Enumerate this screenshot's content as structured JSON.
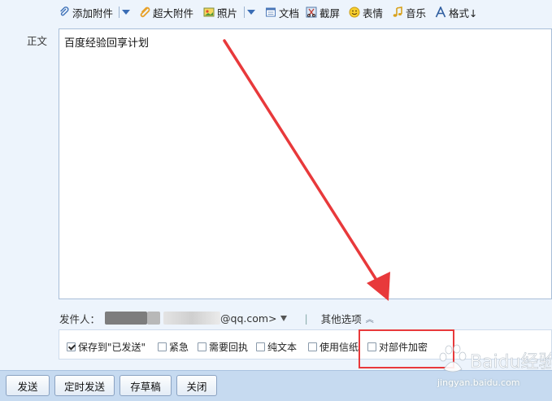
{
  "toolbar": {
    "add_attachment": "添加附件",
    "large_attachment": "超大附件",
    "photo": "照片",
    "document": "文档",
    "screenshot": "截屏",
    "emoji": "表情",
    "music": "音乐",
    "format": "格式↓"
  },
  "compose": {
    "body_label": "正文",
    "body_text": "百度经验回享计划"
  },
  "sender": {
    "label": "发件人：",
    "email_suffix": "@qq.com>",
    "other_options": "其他选项"
  },
  "options": {
    "save_to_sent": "保存到\"已发送\"",
    "urgent": "紧急",
    "need_receipt": "需要回执",
    "plain_text": "纯文本",
    "use_stationery": "使用信纸",
    "encrypt": "对部件加密",
    "save_to_sent_checked": true
  },
  "actions": {
    "send": "发送",
    "scheduled_send": "定时发送",
    "save_draft": "存草稿",
    "close": "关闭"
  },
  "watermark": {
    "brand": "Baidu经验",
    "url": "jingyan.baidu.com"
  },
  "colors": {
    "background": "#edf4fc",
    "accent_blue": "#3a6db5",
    "annotation_red": "#e8393b",
    "bottom_bar": "#c6daf0"
  }
}
